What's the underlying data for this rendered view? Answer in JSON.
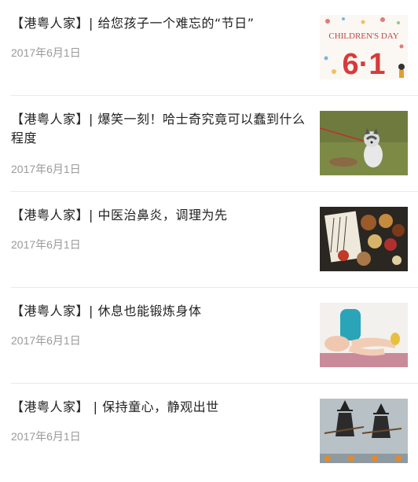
{
  "articles": [
    {
      "title": "【港粤人家】| 给您孩子一个难忘的“节日”",
      "date": "2017年6月1日",
      "thumb_icon": "childrens-day-icon",
      "thumb_text_top": "CHILDREN'S DAY",
      "thumb_text_big": "6·1"
    },
    {
      "title": "【港粤人家】| 爆笑一刻！哈士奇究竟可以蠢到什么程度",
      "date": "2017年6月1日",
      "thumb_icon": "husky-photo"
    },
    {
      "title": "【港粤人家】| 中医治鼻炎，调理为先",
      "date": "2017年6月1日",
      "thumb_icon": "herbal-medicine-photo"
    },
    {
      "title": "【港粤人家】| 休息也能锻炼身体",
      "date": "2017年6月1日",
      "thumb_icon": "exercise-photo"
    },
    {
      "title": "【港粤人家】 | 保持童心，静观出世",
      "date": "2017年6月1日",
      "thumb_icon": "witches-photo"
    }
  ]
}
